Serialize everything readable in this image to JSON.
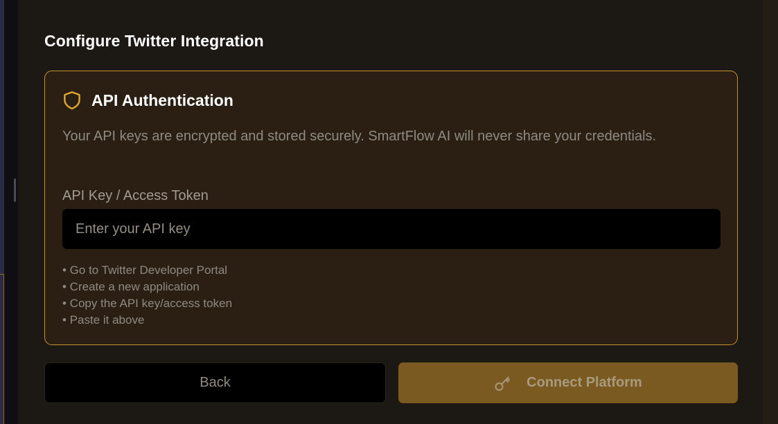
{
  "modal": {
    "title": "Configure Twitter Integration"
  },
  "auth": {
    "icon": "shield-icon",
    "title": "API Authentication",
    "description": "Your API keys are encrypted and stored securely. SmartFlow AI will never share your credentials.",
    "field_label": "API Key / Access Token",
    "input_value": "",
    "input_placeholder": "Enter your API key",
    "steps": [
      "• Go to Twitter Developer Portal",
      "• Create a new application",
      "• Copy the API key/access token",
      "• Paste it above"
    ]
  },
  "actions": {
    "back_label": "Back",
    "connect_label": "Connect Platform",
    "connect_icon": "key-icon"
  },
  "colors": {
    "accent": "#c6932c",
    "card_background": "#2b1f14",
    "connect_button": "#7a5a21"
  }
}
